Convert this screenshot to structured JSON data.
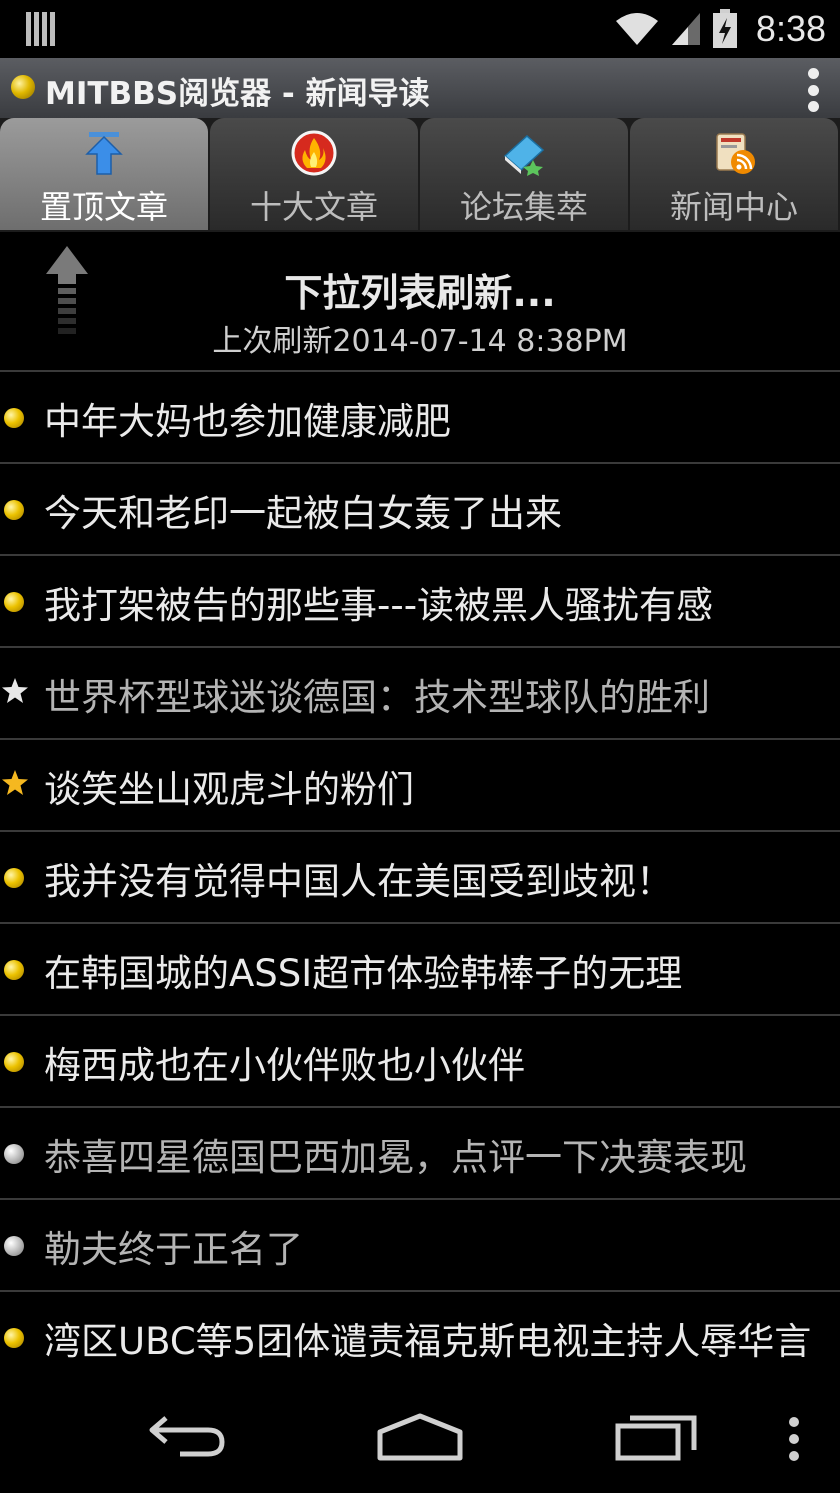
{
  "status_bar": {
    "time": "8:38"
  },
  "app": {
    "title": "MITBBS阅览器 - 新闻导读"
  },
  "tabs": [
    {
      "label": "置顶文章",
      "icon": "upload-arrow-icon",
      "active": true
    },
    {
      "label": "十大文章",
      "icon": "fire-icon",
      "active": false
    },
    {
      "label": "论坛集萃",
      "icon": "book-icon",
      "active": false
    },
    {
      "label": "新闻中心",
      "icon": "news-rss-icon",
      "active": false
    }
  ],
  "refresh": {
    "title": "下拉列表刷新...",
    "subtitle": "上次刷新2014-07-14 8:38PM"
  },
  "articles": [
    {
      "title": "中年大妈也参加健康减肥",
      "marker": "yellow-dot",
      "read": false
    },
    {
      "title": "今天和老印一起被白女轰了出来",
      "marker": "yellow-dot",
      "read": false
    },
    {
      "title": "我打架被告的那些事---读被黑人骚扰有感",
      "marker": "yellow-dot",
      "read": false
    },
    {
      "title": "世界杯型球迷谈德国：技术型球队的胜利",
      "marker": "white-star",
      "read": true
    },
    {
      "title": "谈笑坐山观虎斗的粉们",
      "marker": "gold-star",
      "read": false
    },
    {
      "title": "我并没有觉得中国人在美国受到歧视！",
      "marker": "yellow-dot",
      "read": false
    },
    {
      "title": "在韩国城的ASSI超市体验韩棒子的无理",
      "marker": "yellow-dot",
      "read": false
    },
    {
      "title": "梅西成也在小伙伴败也小伙伴",
      "marker": "yellow-dot",
      "read": false
    },
    {
      "title": "恭喜四星德国巴西加冕，点评一下决赛表现",
      "marker": "gray-dot",
      "read": true
    },
    {
      "title": "勒夫终于正名了",
      "marker": "gray-dot",
      "read": true
    },
    {
      "title": "湾区UBC等5团体谴责福克斯电视主持人辱华言",
      "marker": "yellow-dot",
      "read": false
    }
  ],
  "colors": {
    "accent_yellow": "#ecc200",
    "text": "#eaeaea",
    "read_text": "#b4b4b4"
  }
}
